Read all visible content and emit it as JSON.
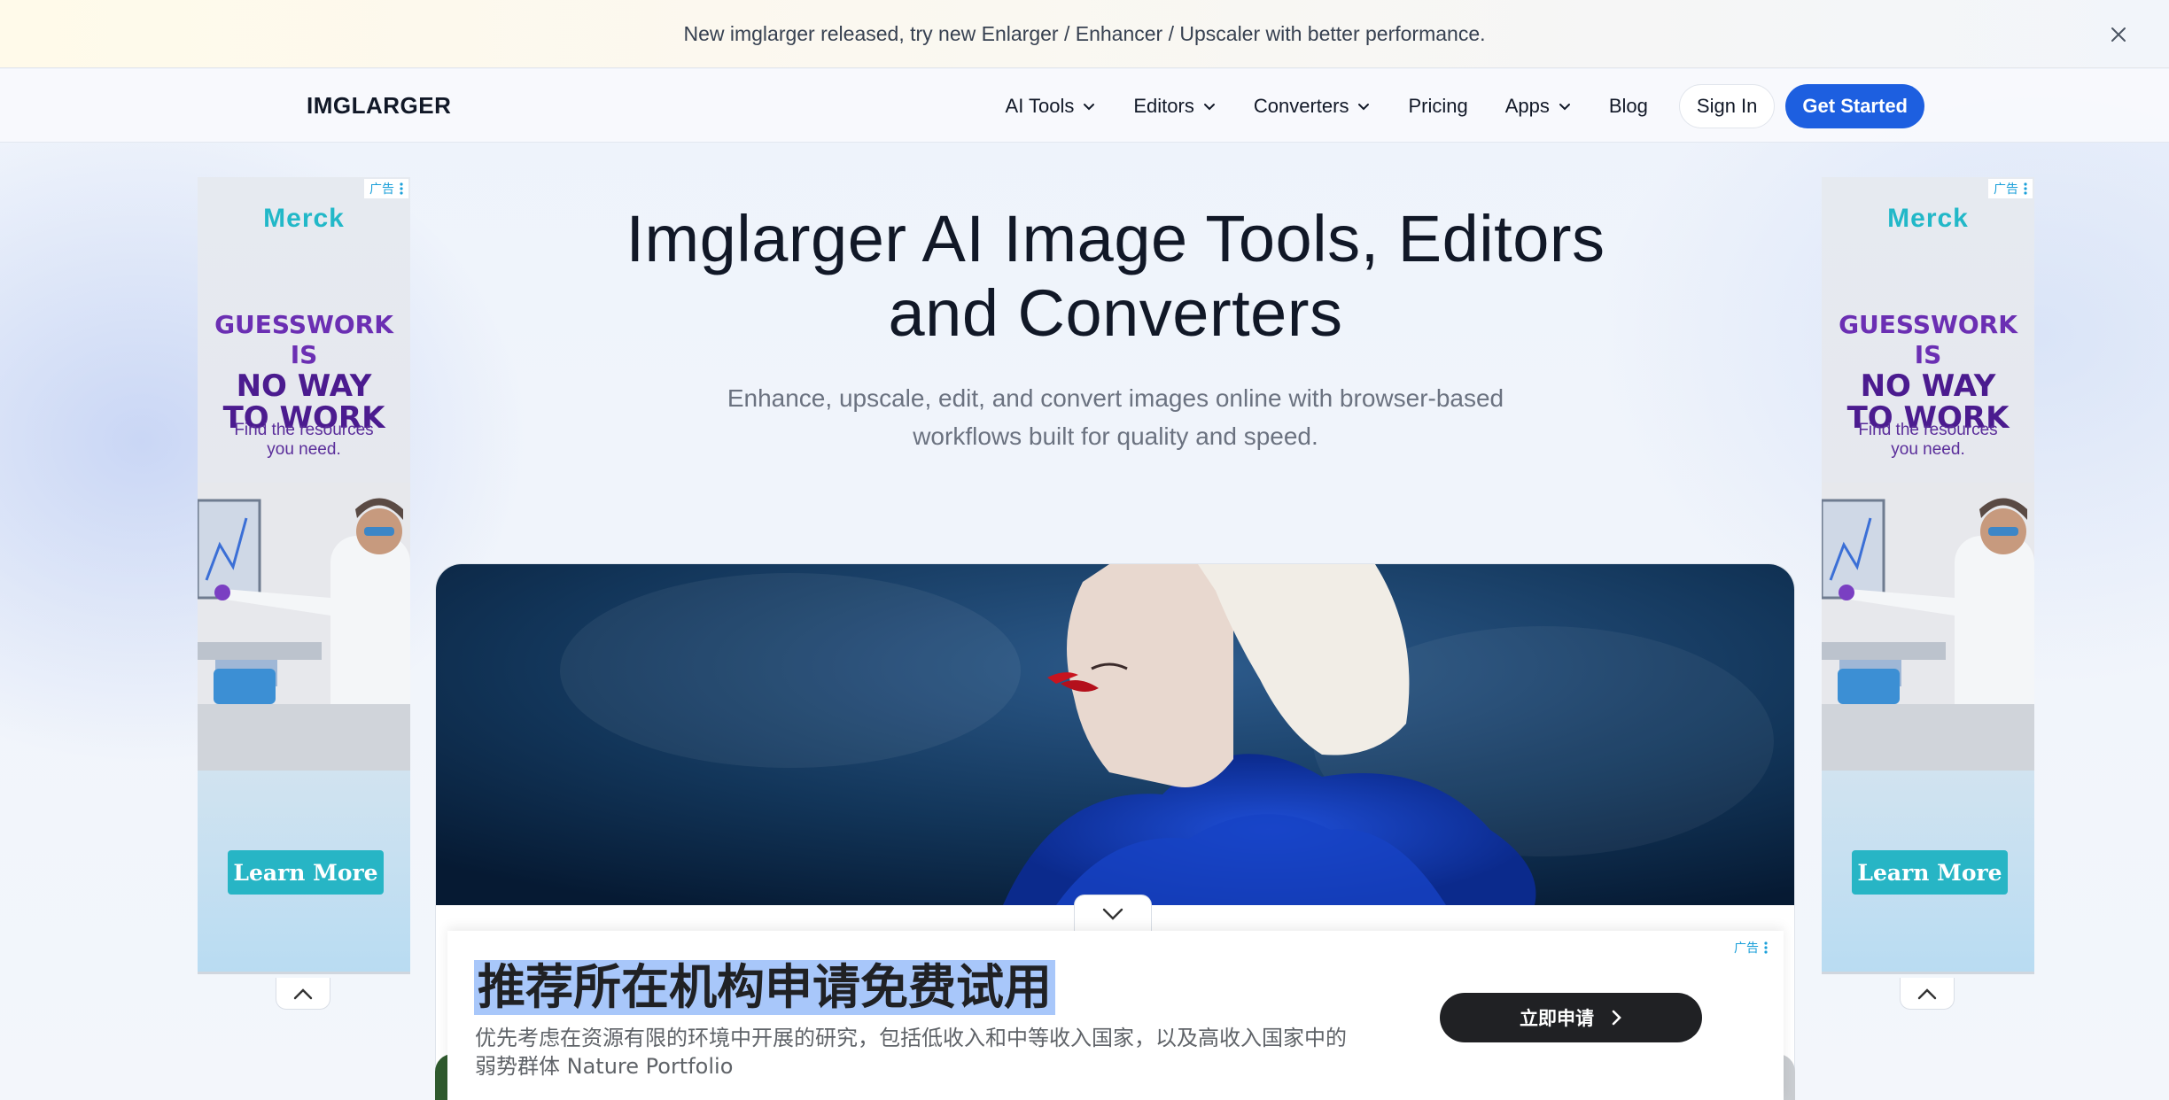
{
  "announcement": {
    "text": "New imglarger released, try new Enlarger / Enhancer / Upscaler with better performance."
  },
  "navbar": {
    "logo": "IMGLARGER",
    "items": [
      {
        "label": "AI Tools",
        "has_dropdown": true
      },
      {
        "label": "Editors",
        "has_dropdown": true
      },
      {
        "label": "Converters",
        "has_dropdown": true
      },
      {
        "label": "Pricing",
        "has_dropdown": false
      },
      {
        "label": "Apps",
        "has_dropdown": true
      },
      {
        "label": "Blog",
        "has_dropdown": false
      }
    ],
    "sign_in": "Sign In",
    "get_started": "Get Started"
  },
  "hero": {
    "title_line1": "Imglarger AI Image Tools, Editors",
    "title_line2": "and Converters",
    "subtitle_line1": "Enhance, upscale, edit, and convert images online with browser-based",
    "subtitle_line2": "workflows built for quality and speed."
  },
  "side_ad": {
    "tag": "广告",
    "brand": "Merck",
    "headline_line1": "GUESSWORK IS",
    "headline_line2": "NO WAY",
    "headline_line3": "TO WORK",
    "copy_line1": "Find the resources",
    "copy_line2": "you need.",
    "cta": "Learn More"
  },
  "bottom_ad": {
    "tag": "广告",
    "title": "推荐所在机构申请免费试用",
    "description_line1": "优先考虑在资源有限的环境中开展的研究，包括低收入和中等收入国家，以及高收入国家中的",
    "description_line2": "弱势群体 Nature Portfolio",
    "cta": "立即申请"
  },
  "colors": {
    "primary": "#1d5fe0",
    "ad_teal": "#27b5c5",
    "ad_purple": "#6b2fb3"
  }
}
